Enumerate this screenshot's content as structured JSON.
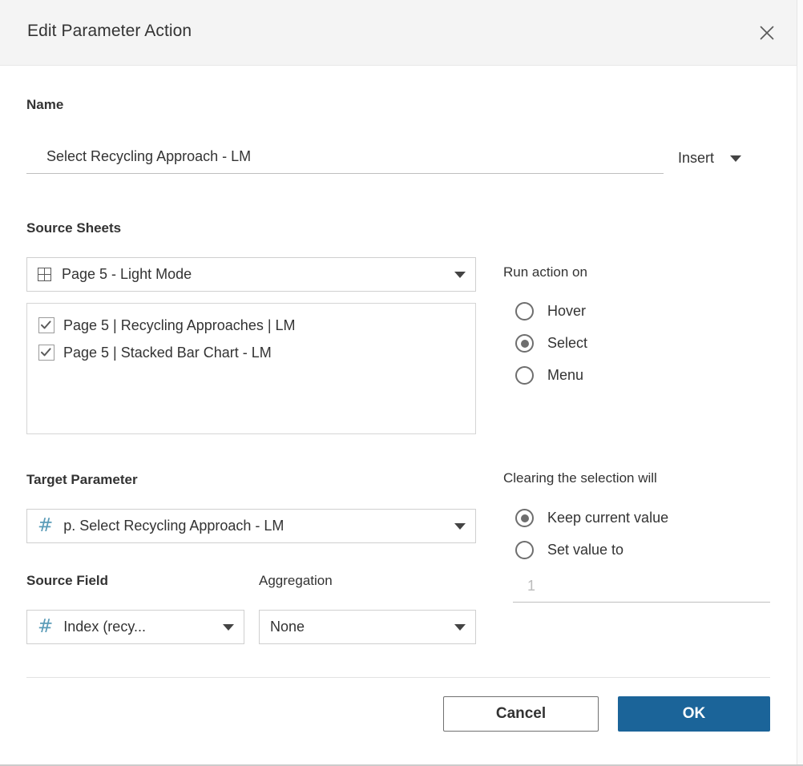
{
  "dialog": {
    "title": "Edit Parameter Action",
    "close_icon": "close-icon"
  },
  "name_section": {
    "label": "Name",
    "value": "Select Recycling Approach - LM",
    "placeholder": "",
    "insert_label": "Insert",
    "insert_caret_icon": "chevron-down-icon"
  },
  "source_sheets": {
    "label": "Source Sheets",
    "dashboard_icon": "dashboard-grid-icon",
    "selected_dashboard": "Page 5 - Light Mode",
    "caret_icon": "chevron-down-icon",
    "sheets": [
      {
        "label": "Page 5 | Recycling Approaches | LM",
        "checked": true
      },
      {
        "label": "Page 5 | Stacked Bar Chart - LM",
        "checked": true
      }
    ]
  },
  "run_action_on": {
    "label": "Run action on",
    "options": [
      {
        "label": "Hover",
        "selected": false
      },
      {
        "label": "Select",
        "selected": true
      },
      {
        "label": "Menu",
        "selected": false
      }
    ]
  },
  "target_parameter": {
    "label": "Target Parameter",
    "param_icon": "number-parameter-icon",
    "value": "p. Select Recycling Approach - LM",
    "caret_icon": "chevron-down-icon"
  },
  "source_field": {
    "label": "Source Field",
    "field_icon": "number-parameter-icon",
    "value": "Index (recy...",
    "caret_icon": "chevron-down-icon"
  },
  "aggregation": {
    "label": "Aggregation",
    "value": "None",
    "caret_icon": "chevron-down-icon"
  },
  "clearing_selection": {
    "label": "Clearing the selection will",
    "options": [
      {
        "label": "Keep current value",
        "selected": true
      },
      {
        "label": "Set value to",
        "selected": false
      }
    ],
    "set_value_placeholder": "1",
    "set_value_current": ""
  },
  "footer": {
    "cancel_label": "Cancel",
    "ok_label": "OK"
  },
  "colors": {
    "primary_button": "#1b6499",
    "header_bg": "#f4f4f4",
    "param_icon": "#5b9cb8",
    "text": "#333333",
    "border": "#cfcfcf"
  }
}
